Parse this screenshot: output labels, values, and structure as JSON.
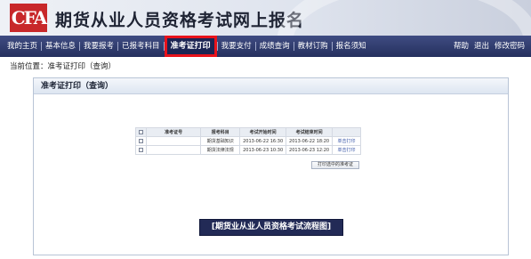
{
  "site": {
    "logo_text": "CFA",
    "title": "期货从业人员资格考试网上报名"
  },
  "nav": {
    "items": [
      {
        "label": "我的主页"
      },
      {
        "label": "基本信息"
      },
      {
        "label": "我要报考"
      },
      {
        "label": "已报考科目"
      },
      {
        "label": "准考证打印",
        "active": true
      },
      {
        "label": "我要支付"
      },
      {
        "label": "成绩查询"
      },
      {
        "label": "教材订购"
      },
      {
        "label": "报名须知"
      }
    ],
    "right": {
      "help": "帮助",
      "logout": "退出",
      "change_password": "修改密码"
    },
    "highlight_color": "#e8121b"
  },
  "breadcrumb": {
    "text": "当前位置：准考证打印（查询）"
  },
  "panel": {
    "title": "准考证打印（查询）"
  },
  "table": {
    "headers": [
      "",
      "准考证号",
      "报考科目",
      "考试开始时间",
      "考试结束时间",
      ""
    ],
    "rows": [
      {
        "admission_no": "",
        "subject": "期货基础知识",
        "start": "2013-06-22 16:30",
        "end": "2013-06-22 18:20",
        "action": "单击打印"
      },
      {
        "admission_no": "",
        "subject": "期货法律法规",
        "start": "2013-06-23 10:30",
        "end": "2013-06-23 12:20",
        "action": "单击打印"
      }
    ],
    "print_selected": "打印选中的准考证"
  },
  "flow_button": {
    "label": "[期货业从业人员资格考试流程图]"
  }
}
